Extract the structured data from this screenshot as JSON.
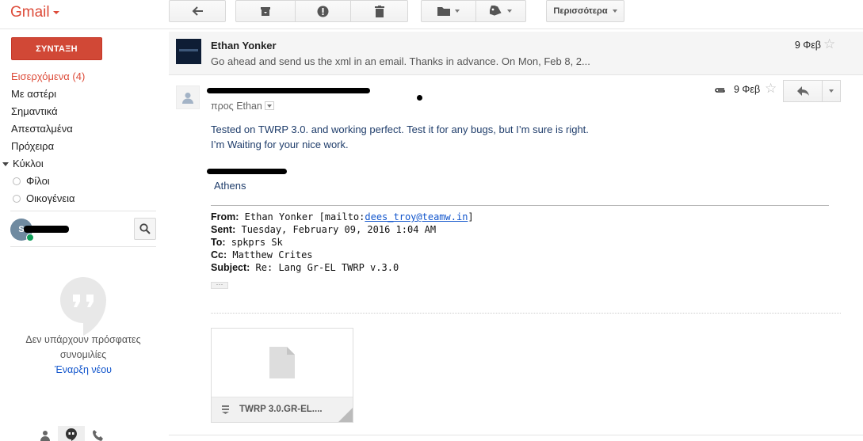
{
  "app": {
    "logo": "Gmail"
  },
  "toolbar": {
    "more_label": "Περισσότερα"
  },
  "sidebar": {
    "compose_label": "ΣΥΝΤΑΞΗ",
    "items": [
      {
        "label": "Εισερχόμενα (4)",
        "active": true
      },
      {
        "label": "Με αστέρι"
      },
      {
        "label": "Σημαντικά"
      },
      {
        "label": "Απεσταλμένα"
      },
      {
        "label": "Πρόχειρα"
      }
    ],
    "circles_label": "Κύκλοι",
    "circles": [
      {
        "label": "Φίλοι"
      },
      {
        "label": "Οικογένεια"
      }
    ]
  },
  "hangouts": {
    "avatar_letter": "S",
    "empty_text_1": "Δεν υπάρχουν πρόσφατες",
    "empty_text_2": "συνομιλίες",
    "start_link": "Έναρξη νέου"
  },
  "thread": {
    "collapsed": {
      "sender": "Ethan Yonker",
      "snippet": "Go ahead and send us the xml in an email. Thanks in advance. On Mon, Feb 8, 2...",
      "date": "9 Φεβ"
    },
    "expanded": {
      "to_prefix": "προς",
      "to_name": "Ethan",
      "date": "9 Φεβ",
      "body_line_1": "Tested on TWRP 3.0. and working perfect. Test it for any bugs, but I’m sure is right.",
      "body_line_2": "I’m Waiting for your nice work.",
      "city": "Athens",
      "quoted": {
        "from_label": "From:",
        "from_value": "Ethan Yonker [mailto:",
        "from_email": "dees_troy@teamw.in",
        "from_close": "]",
        "sent_label": "Sent:",
        "sent_value": "Tuesday, February 09, 2016 1:04 AM",
        "to_label": "To:",
        "to_value": "spkprs Sk",
        "cc_label": "Cc:",
        "cc_value": "Matthew Crites",
        "subject_label": "Subject:",
        "subject_value": "Re: Lang Gr-EL TWRP v.3.0"
      },
      "attachment": {
        "name": "TWRP 3.0.GR-EL...."
      }
    }
  },
  "colors": {
    "brand_red": "#dd4b39",
    "compose_red": "#d14836",
    "link_blue": "#1155cc",
    "body_text_blue": "#1f3d6b",
    "presence_green": "#0f9d58"
  },
  "icons": [
    "back-arrow-icon",
    "archive-icon",
    "spam-icon",
    "trash-icon",
    "folder-icon",
    "label-icon",
    "star-icon",
    "paperclip-icon",
    "reply-icon",
    "search-icon",
    "hangouts-bubble-icon",
    "file-icon",
    "person-icon",
    "phone-icon"
  ]
}
